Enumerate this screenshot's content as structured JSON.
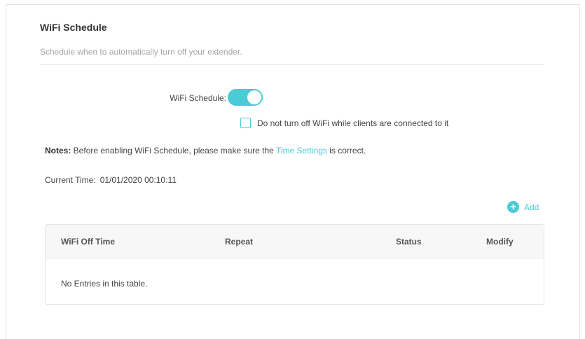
{
  "page": {
    "title": "WiFi Schedule",
    "subtitle": "Schedule when to automatically turn off your extender."
  },
  "schedule": {
    "label": "WiFi Schedule:",
    "enabled": true,
    "toggle_color": "#4acbd6"
  },
  "clients_option": {
    "label": "Do not turn off WiFi while clients are connected to it",
    "checked": false
  },
  "notes": {
    "label": "Notes:",
    "text_before": " Before enabling WiFi Schedule, please make sure the ",
    "link": "Time Settings",
    "text_after": " is correct."
  },
  "current_time": {
    "label": "Current Time:",
    "value": "01/01/2020 00:10:11"
  },
  "add": {
    "icon": "plus-circle-icon",
    "label": "Add"
  },
  "table": {
    "columns": [
      "WiFi Off Time",
      "Repeat",
      "Status",
      "Modify"
    ],
    "empty_message": "No Entries in this table."
  },
  "colors": {
    "accent": "#4acbd6",
    "text": "#444444",
    "muted": "#a6a6a6"
  }
}
